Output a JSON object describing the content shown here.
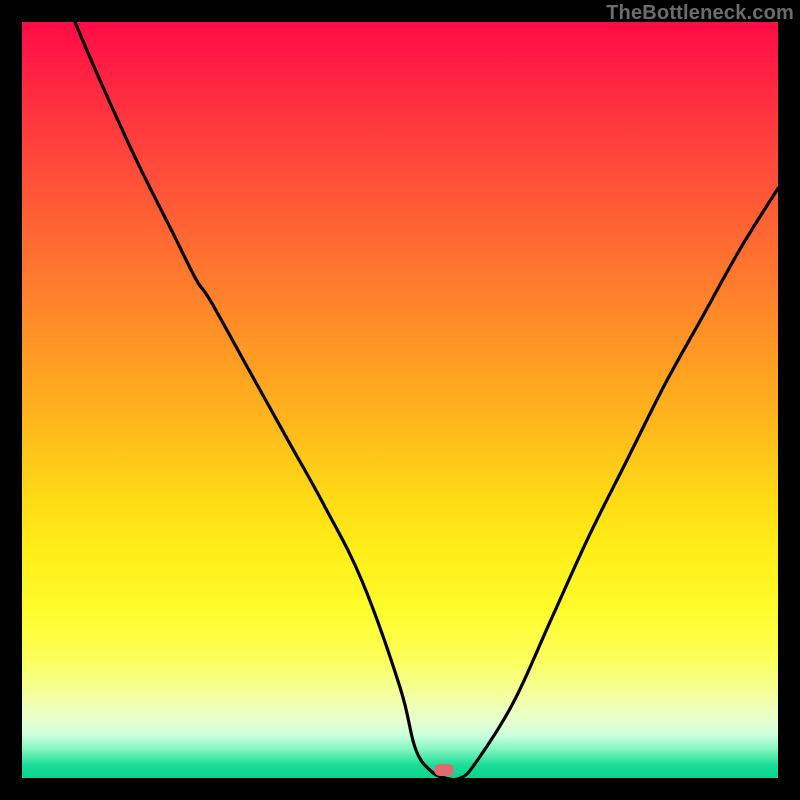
{
  "watermark": "TheBottleneck.com",
  "marker": {
    "color": "#e06a6f",
    "x_pct": 55.8,
    "y_pct": 99.0
  },
  "chart_data": {
    "type": "line",
    "title": "",
    "xlabel": "",
    "ylabel": "",
    "xlim": [
      0,
      100
    ],
    "ylim": [
      0,
      100
    ],
    "grid": false,
    "legend": false,
    "background": "vertical red→orange→yellow→green gradient (green at bottom)",
    "series": [
      {
        "name": "bottleneck-curve",
        "color": "#000000",
        "x": [
          7,
          10,
          15,
          20,
          23,
          25,
          30,
          35,
          40,
          45,
          50,
          52,
          54,
          56,
          58,
          60,
          65,
          70,
          75,
          80,
          85,
          90,
          95,
          100
        ],
        "y": [
          100,
          93,
          82,
          72,
          66,
          63,
          54,
          45,
          36,
          26,
          12,
          4,
          1,
          0,
          0,
          2,
          10,
          21,
          32,
          42,
          52,
          61,
          70,
          78
        ]
      }
    ],
    "annotations": [
      {
        "type": "marker",
        "shape": "rounded-rect",
        "x": 55.8,
        "y": 1.0,
        "color": "#e06a6f"
      }
    ]
  }
}
